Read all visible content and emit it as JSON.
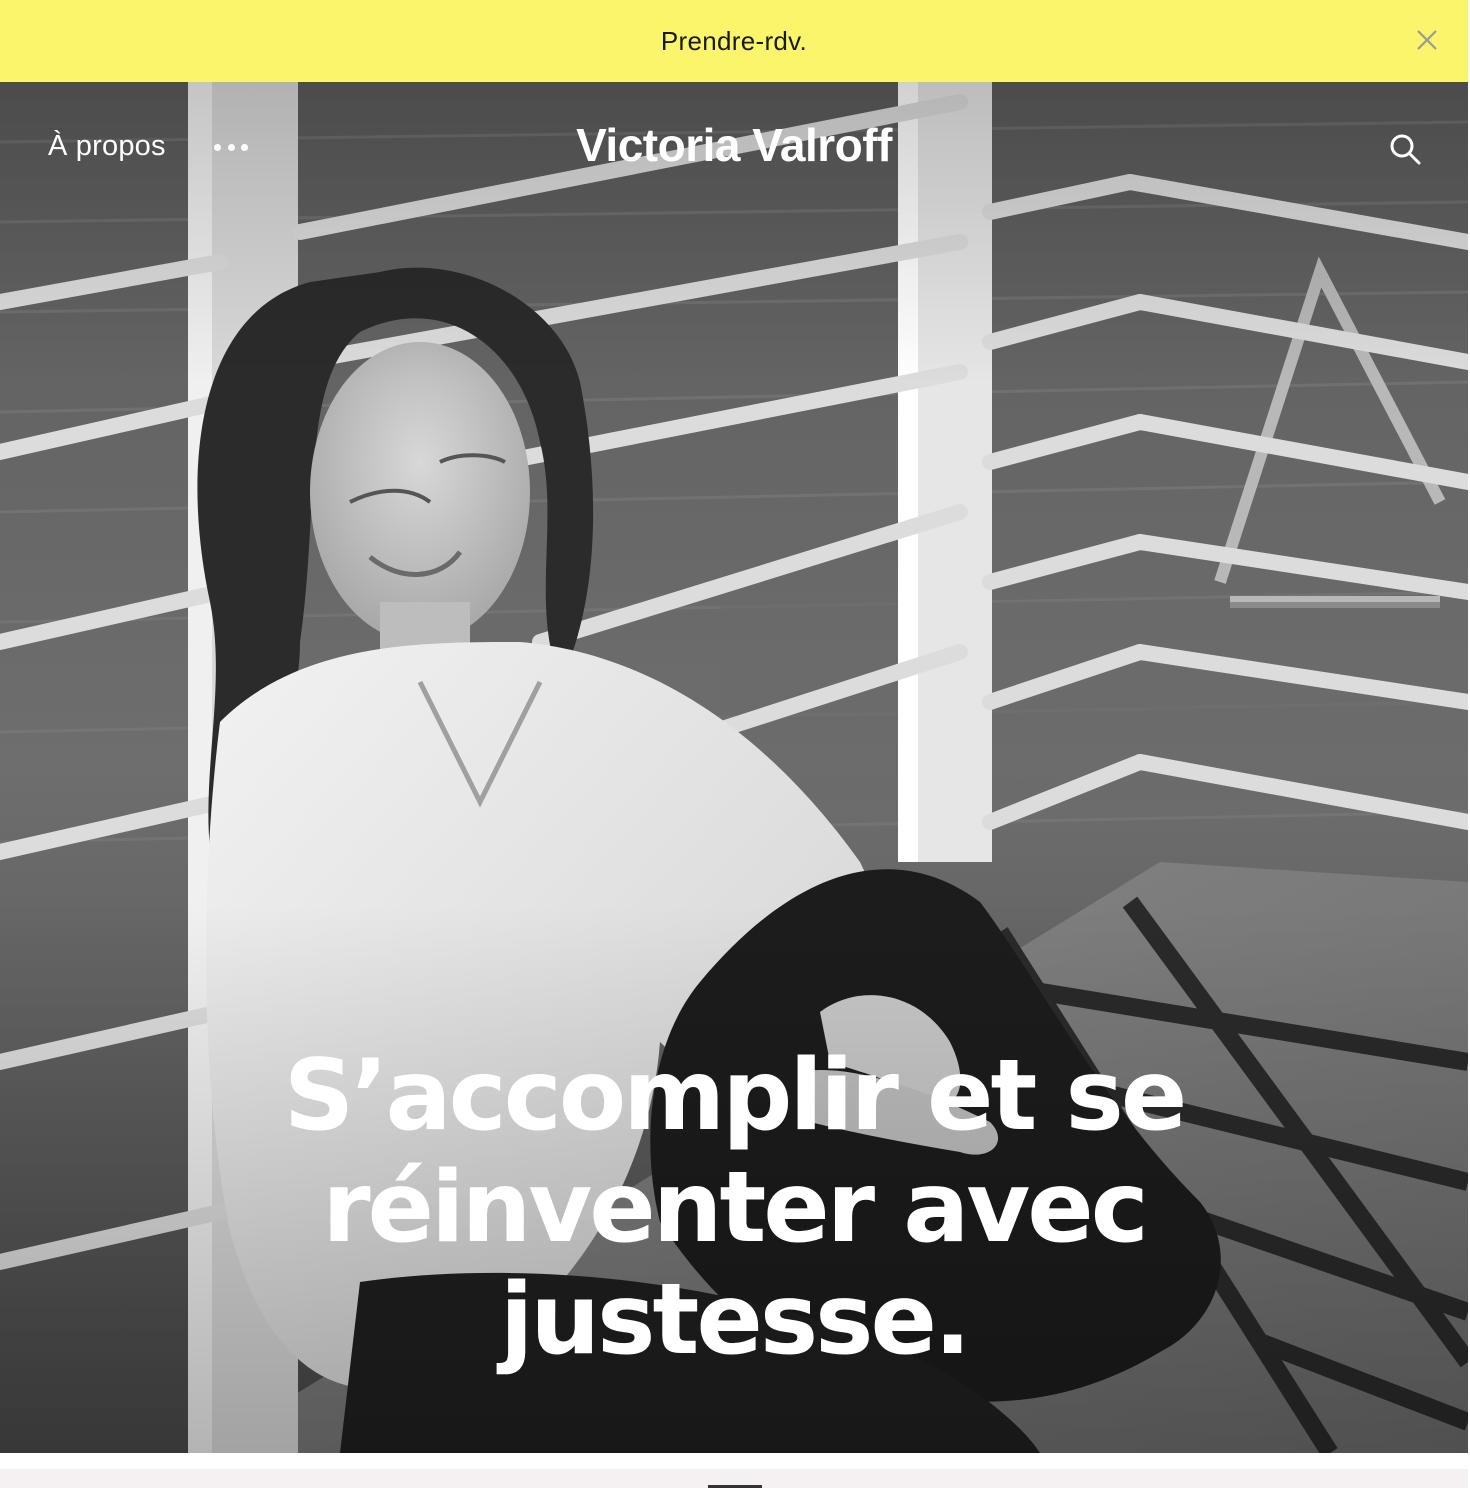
{
  "announcement": {
    "label": "Prendre-rdv."
  },
  "header": {
    "about_label": "À propos",
    "site_title": "Victoria Valroff"
  },
  "hero": {
    "headline_line1": "S’accomplir et se",
    "headline_line2": "réinventer avec",
    "headline_line3": "justesse."
  },
  "colors": {
    "announcement_bg": "#fbf56b",
    "text_light": "#ffffff",
    "text_dark": "#1a1a1a"
  },
  "icons": {
    "close": "close-icon",
    "more": "more-dots-icon",
    "search": "search-icon"
  }
}
